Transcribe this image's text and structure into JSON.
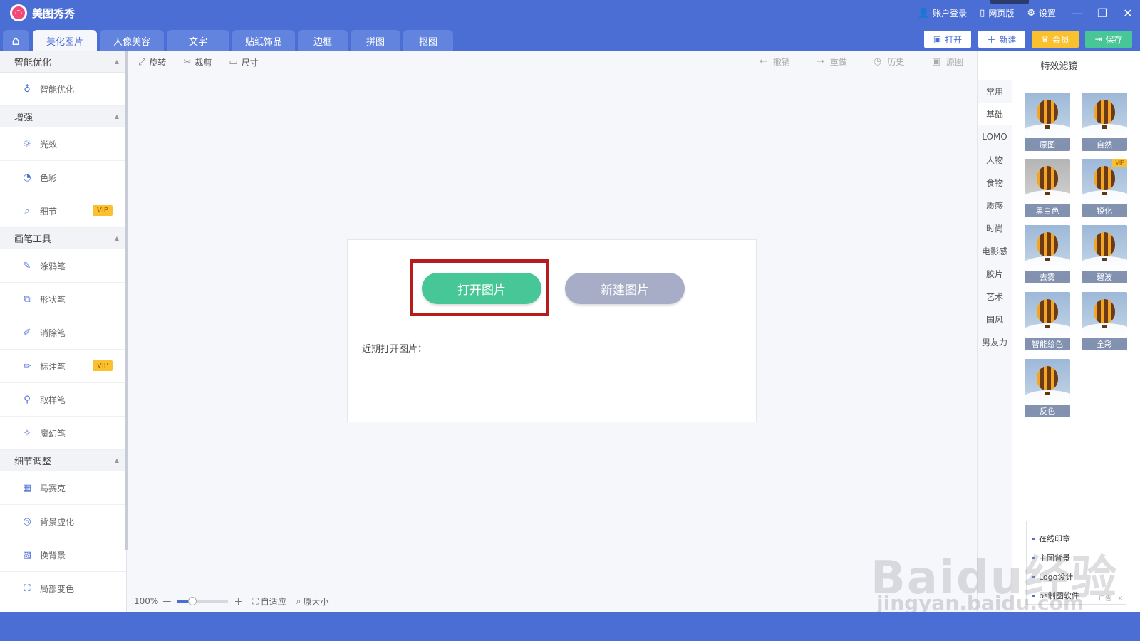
{
  "app": {
    "title": "美图秀秀"
  },
  "titlebar": {
    "login": "账户登录",
    "web": "网页版",
    "settings": "设置"
  },
  "tabs": [
    {
      "label": "美化图片",
      "active": true
    },
    {
      "label": "人像美容"
    },
    {
      "label": "文字"
    },
    {
      "label": "贴纸饰品"
    },
    {
      "label": "边框"
    },
    {
      "label": "拼图"
    },
    {
      "label": "抠图"
    }
  ],
  "actions": {
    "open": "打开",
    "new": "新建",
    "member": "会员",
    "save": "保存"
  },
  "sidebar": {
    "sections": [
      {
        "title": "智能优化",
        "items": [
          {
            "label": "智能优化",
            "icon": "bulb-icon"
          }
        ]
      },
      {
        "title": "增强",
        "items": [
          {
            "label": "光效",
            "icon": "sun-icon"
          },
          {
            "label": "色彩",
            "icon": "palette-icon"
          },
          {
            "label": "细节",
            "icon": "magnifier-icon",
            "vip": "VIP"
          }
        ]
      },
      {
        "title": "画笔工具",
        "items": [
          {
            "label": "涂鸦笔",
            "icon": "doodle-icon"
          },
          {
            "label": "形状笔",
            "icon": "shape-icon"
          },
          {
            "label": "消除笔",
            "icon": "eraser-icon"
          },
          {
            "label": "标注笔",
            "icon": "marker-icon",
            "vip": "VIP"
          },
          {
            "label": "取样笔",
            "icon": "dropper-icon"
          },
          {
            "label": "魔幻笔",
            "icon": "magic-wand-icon"
          }
        ]
      },
      {
        "title": "细节调整",
        "items": [
          {
            "label": "马赛克",
            "icon": "mosaic-icon"
          },
          {
            "label": "背景虚化",
            "icon": "blur-icon"
          },
          {
            "label": "换背景",
            "icon": "background-icon"
          },
          {
            "label": "局部变色",
            "icon": "recolor-icon"
          }
        ]
      }
    ]
  },
  "toolbar": {
    "rotate": "旋转",
    "crop": "裁剪",
    "size": "尺寸",
    "undo": "撤销",
    "redo": "重做",
    "history": "历史",
    "original": "原图"
  },
  "welcome": {
    "open_btn": "打开图片",
    "new_btn": "新建图片",
    "recent_label": "近期打开图片："
  },
  "filters": {
    "title": "特效滤镜",
    "categories": [
      "常用",
      "基础",
      "LOMO",
      "人物",
      "食物",
      "质感",
      "时尚",
      "电影感",
      "胶片",
      "艺术",
      "国风",
      "男友力"
    ],
    "active_category": "基础",
    "items": [
      {
        "label": "原图"
      },
      {
        "label": "自然"
      },
      {
        "label": "黑白色"
      },
      {
        "label": "锐化",
        "vip": "VIP"
      },
      {
        "label": "去雾"
      },
      {
        "label": "碧波"
      },
      {
        "label": "智能绘色"
      },
      {
        "label": "全彩"
      },
      {
        "label": "反色"
      }
    ]
  },
  "ad": {
    "items": [
      "在线印章",
      "主图背景",
      "Logo设计",
      "ps制图软件"
    ],
    "tag": "广告"
  },
  "zoom": {
    "value": "100%",
    "fit": "自适应",
    "actual": "原大小"
  },
  "watermark": {
    "text": "Baidu经验",
    "sub": "jingyan.baidu.com"
  },
  "colors": {
    "brand": "#4b6ed5",
    "open_btn": "#47c797",
    "new_btn": "#a7adc6",
    "highlight": "#b71c1c",
    "vip": "#fbc02d"
  }
}
